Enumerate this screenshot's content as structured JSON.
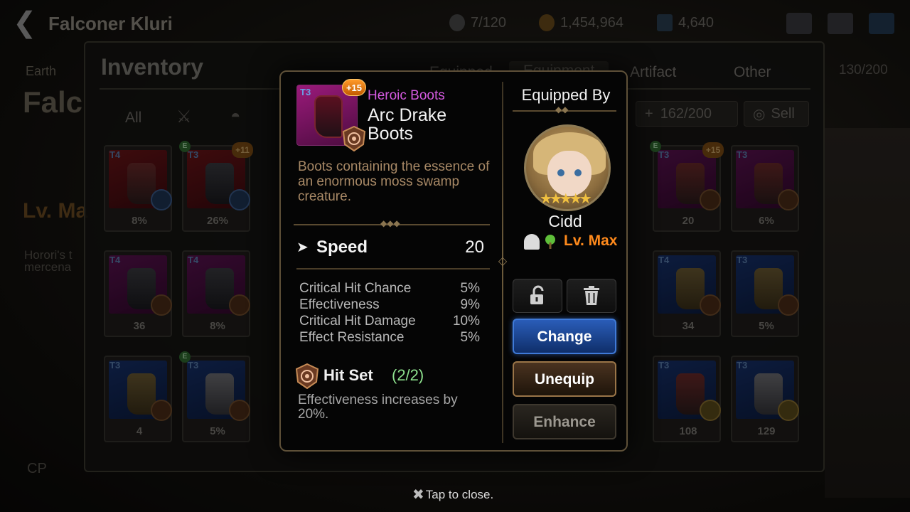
{
  "header": {
    "hero_name": "Falconer Kluri",
    "stamina": "7/120",
    "gold": "1,454,964",
    "crystals": "4,640"
  },
  "left_panel": {
    "element": "Earth",
    "name_fragment": "Falc",
    "level": "Lv. Ma",
    "desc_line1": "Horori's t",
    "desc_line2": "mercena",
    "cp_label": "CP"
  },
  "inventory": {
    "title": "Inventory",
    "tabs": [
      "Equipped",
      "Equipment",
      "Artifact",
      "Other"
    ],
    "top_count": "130/200",
    "filter_all": "All",
    "capacity": "162/200",
    "sell": "Sell",
    "slots": [
      {
        "tier": "T4",
        "stat": "8%",
        "e": false,
        "plus": ""
      },
      {
        "tier": "T3",
        "stat": "26%",
        "e": true,
        "plus": "+11"
      },
      {
        "tier": "T3",
        "stat": "20",
        "e": true,
        "plus": "+15"
      },
      {
        "tier": "T3",
        "stat": "6%",
        "e": false,
        "plus": ""
      },
      {
        "tier": "T4",
        "stat": "36",
        "e": false,
        "plus": ""
      },
      {
        "tier": "T4",
        "stat": "8%",
        "e": false,
        "plus": ""
      },
      {
        "tier": "T4",
        "stat": "34",
        "e": false,
        "plus": ""
      },
      {
        "tier": "T3",
        "stat": "5%",
        "e": false,
        "plus": ""
      },
      {
        "tier": "T3",
        "stat": "4",
        "e": false,
        "plus": ""
      },
      {
        "tier": "T3",
        "stat": "5%",
        "e": true,
        "plus": ""
      },
      {
        "tier": "T3",
        "stat": "108",
        "e": false,
        "plus": ""
      },
      {
        "tier": "T3",
        "stat": "129",
        "e": false,
        "plus": ""
      }
    ]
  },
  "item": {
    "tier": "T3",
    "plus": "+15",
    "rarity": "Heroic Boots",
    "name": "Arc Drake Boots",
    "description": "Boots containing the essence of an enormous moss swamp creature.",
    "main_stat": {
      "label": "Speed",
      "value": "20"
    },
    "sub_stats": [
      {
        "label": "Critical Hit Chance",
        "value": "5%"
      },
      {
        "label": "Effectiveness",
        "value": "9%"
      },
      {
        "label": "Critical Hit Damage",
        "value": "10%"
      },
      {
        "label": "Effect Resistance",
        "value": "5%"
      }
    ],
    "set": {
      "name": "Hit Set",
      "count": "(2/2)",
      "description": "Effectiveness increases by 20%."
    }
  },
  "equipped_by": {
    "title": "Equipped By",
    "character": "Cidd",
    "stars": 5,
    "level": "Lv. Max"
  },
  "buttons": {
    "change": "Change",
    "unequip": "Unequip",
    "enhance": "Enhance"
  },
  "footer": {
    "tap_close": "Tap to close."
  },
  "colors": {
    "rarity": "#d45ae0",
    "level": "#ff8a1c",
    "set_count": "#8de08d",
    "desc": "#a88966"
  }
}
